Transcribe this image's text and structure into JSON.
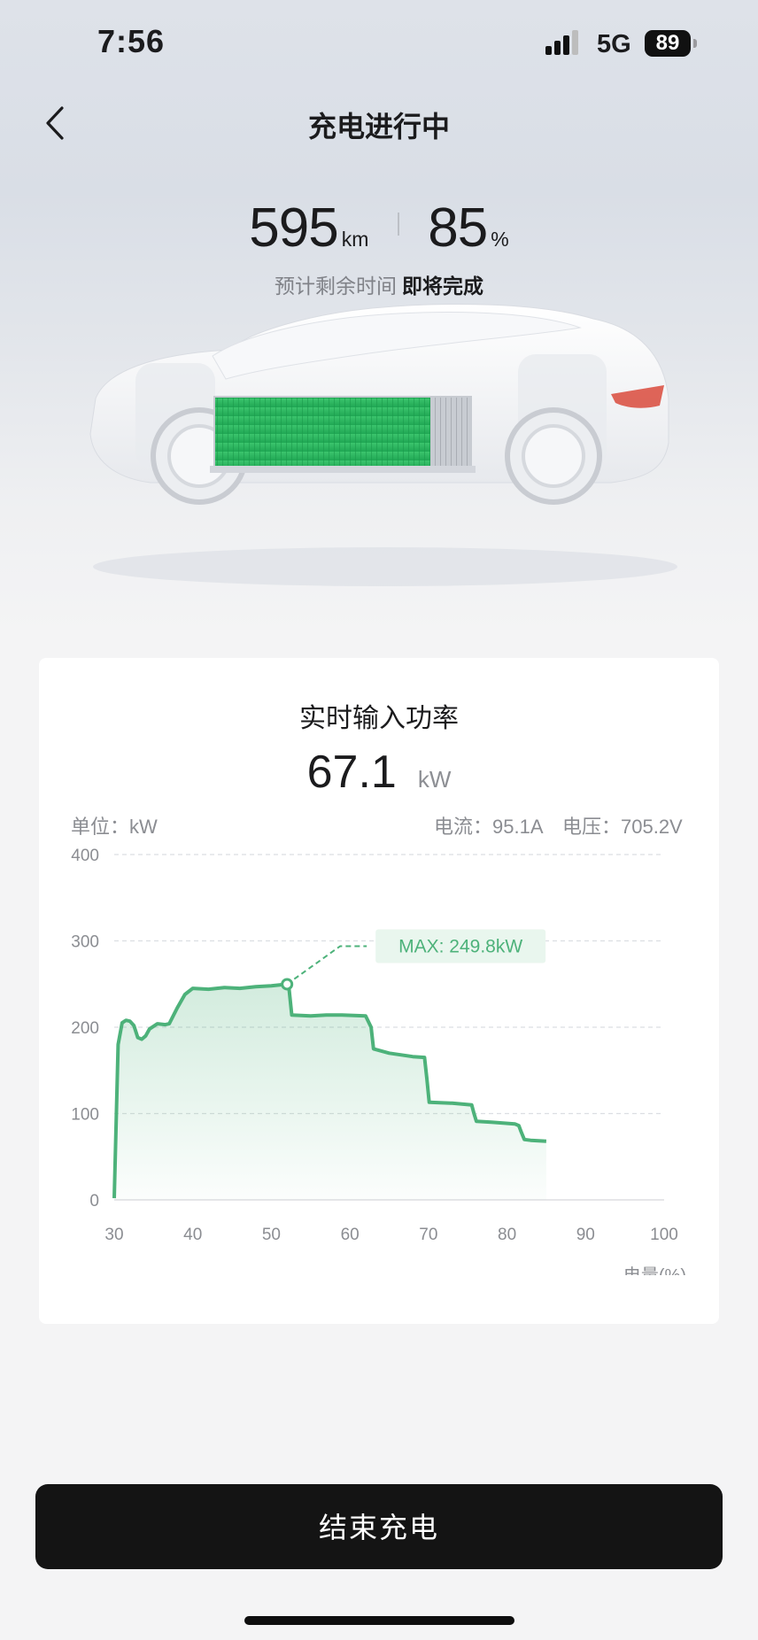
{
  "status_bar": {
    "time": "7:56",
    "network": "5G",
    "battery": "89"
  },
  "header": {
    "title": "充电进行中"
  },
  "stats": {
    "range_value": "595",
    "range_unit": "km",
    "soc_value": "85",
    "soc_unit": "%",
    "eta_label": "预计剩余时间",
    "eta_value": "即将完成"
  },
  "power_card": {
    "title": "实时输入功率",
    "value": "67.1",
    "unit": "kW",
    "unit_label": "单位：kW",
    "current": "电流：95.1A",
    "voltage": "电压：705.2V"
  },
  "chart_data": {
    "type": "area",
    "xlabel": "电量(%)",
    "ylabel": "单位：kW",
    "xlim": [
      30,
      100
    ],
    "ylim": [
      0,
      400
    ],
    "x_ticks": [
      30,
      40,
      50,
      60,
      70,
      80,
      90,
      100
    ],
    "y_ticks": [
      0,
      100,
      200,
      300,
      400
    ],
    "grid": true,
    "color": "#4db27a",
    "annotation": {
      "text": "MAX: 249.8kW",
      "x": 52,
      "y": 249.8
    },
    "series": [
      {
        "x": [
          30,
          30.5,
          31,
          31.5,
          32,
          32.5,
          33,
          33.5,
          34,
          34.5,
          35.5,
          36.5,
          37,
          38,
          38.5,
          39,
          40,
          42,
          44,
          46,
          48,
          50,
          52,
          52.2,
          52.6,
          55,
          57,
          59,
          62,
          62.7,
          63,
          65,
          68,
          69.5,
          69.8,
          70.1,
          73,
          75.5,
          75.8,
          76.1,
          78,
          81,
          81.5,
          81.8,
          82.2,
          83,
          85
        ],
        "y": [
          2,
          180,
          205,
          208,
          207,
          202,
          188,
          186,
          190,
          198,
          204,
          203,
          204,
          222,
          230,
          238,
          245,
          244,
          246,
          245,
          247,
          248,
          249.8,
          249.6,
          214,
          213,
          214,
          214,
          213,
          200,
          175,
          170,
          166,
          165,
          140,
          113,
          112,
          110,
          100,
          91,
          90,
          88,
          86,
          79,
          70,
          69,
          68
        ]
      }
    ]
  },
  "footer": {
    "end_button": "结束充电"
  },
  "icons": {
    "back": "chevron-left-icon",
    "signal": "signal-bars-icon",
    "battery": "battery-icon"
  },
  "colors": {
    "accent_green": "#4db27a",
    "button_bg": "#141414"
  }
}
